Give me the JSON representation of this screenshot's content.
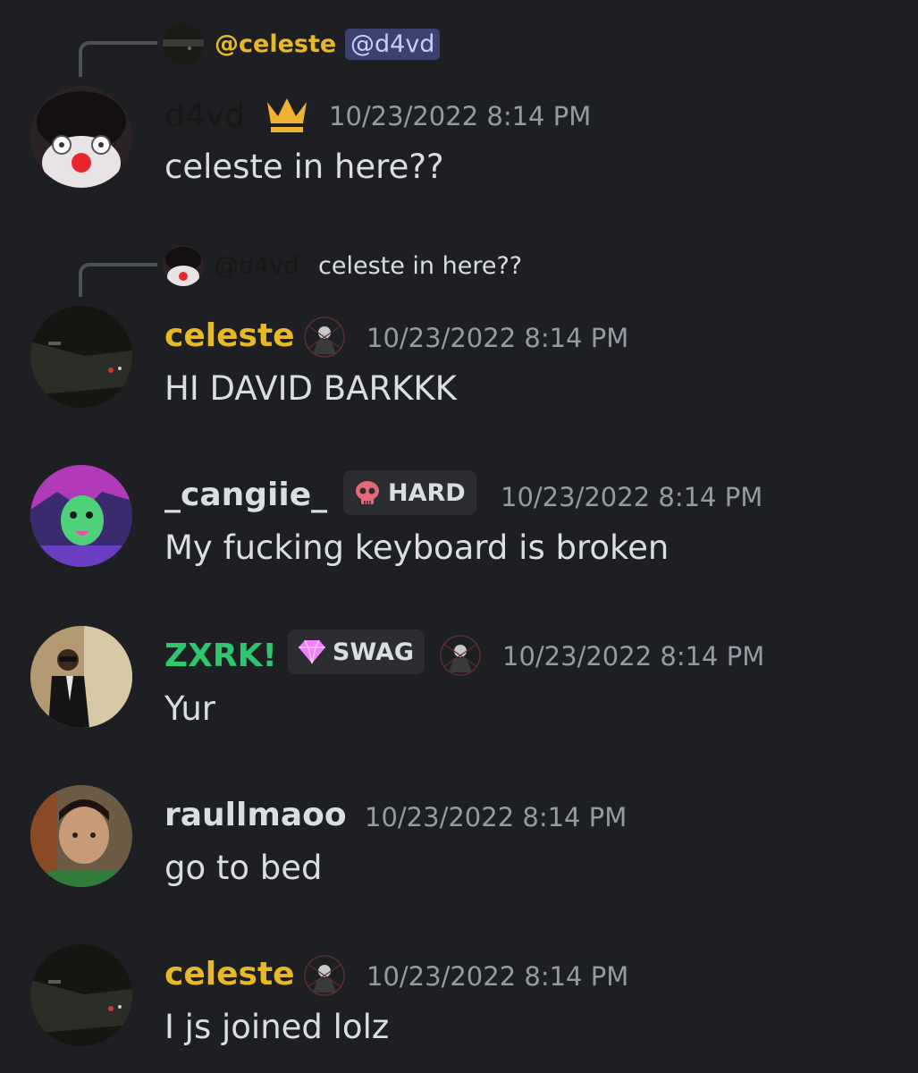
{
  "colors": {
    "background": "#1e1f22",
    "timestamp": "#949ba4",
    "message_text": "#dbdee1",
    "name_yellow": "#e7b925",
    "name_green": "#2dc770",
    "name_dark": "#1a1717",
    "mention_bg": "#3c4270"
  },
  "messages": [
    {
      "reply": {
        "author": "@celeste",
        "mention": "@d4vd"
      },
      "author": "d4vd",
      "icon": "crown-icon",
      "timestamp": "10/23/2022 8:14 PM",
      "text": "celeste in here??"
    },
    {
      "reply": {
        "author": "@d4vd",
        "text": "celeste in here??"
      },
      "author": "celeste",
      "icon": "role-avatar-icon",
      "timestamp": "10/23/2022 8:14 PM",
      "text": "HI DAVID BARKKK"
    },
    {
      "author": "_cangiie_",
      "tag": {
        "label": "HARD",
        "icon": "skull-icon"
      },
      "timestamp": "10/23/2022 8:14 PM",
      "text": "My fucking keyboard is broken"
    },
    {
      "author": "ZXRK!",
      "tag": {
        "label": "SWAG",
        "icon": "diamond-icon"
      },
      "icon": "role-avatar-icon",
      "timestamp": "10/23/2022 8:14 PM",
      "text": "Yur"
    },
    {
      "author": "raullmaoo",
      "timestamp": "10/23/2022 8:14 PM",
      "text": "go to bed"
    },
    {
      "author": "celeste",
      "icon": "role-avatar-icon",
      "timestamp": "10/23/2022 8:14 PM",
      "text": "I js joined lolz"
    }
  ]
}
